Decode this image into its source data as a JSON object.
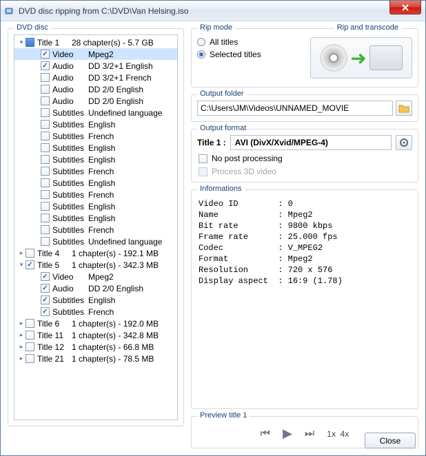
{
  "window": {
    "title": "DVD disc ripping from C:\\DVD\\Van Helsing.iso"
  },
  "tree": {
    "header": "DVD disc",
    "rows": [
      {
        "lvl": 0,
        "exp": "▾",
        "chk": "part",
        "c1": "Title 1",
        "c2": "28 chapter(s) - 5.7 GB"
      },
      {
        "lvl": 1,
        "chk": "on",
        "c1": "Video",
        "c2": "Mpeg2",
        "sel": true
      },
      {
        "lvl": 1,
        "chk": "on",
        "c1": "Audio",
        "c2": "DD 3/2+1 English"
      },
      {
        "lvl": 1,
        "chk": "off",
        "c1": "Audio",
        "c2": "DD 3/2+1 French"
      },
      {
        "lvl": 1,
        "chk": "off",
        "c1": "Audio",
        "c2": "DD 2/0 English"
      },
      {
        "lvl": 1,
        "chk": "off",
        "c1": "Audio",
        "c2": "DD 2/0 English"
      },
      {
        "lvl": 1,
        "chk": "off",
        "c1": "Subtitles",
        "c2": "Undefined language"
      },
      {
        "lvl": 1,
        "chk": "off",
        "c1": "Subtitles",
        "c2": "English"
      },
      {
        "lvl": 1,
        "chk": "off",
        "c1": "Subtitles",
        "c2": "French"
      },
      {
        "lvl": 1,
        "chk": "off",
        "c1": "Subtitles",
        "c2": "English"
      },
      {
        "lvl": 1,
        "chk": "off",
        "c1": "Subtitles",
        "c2": "English"
      },
      {
        "lvl": 1,
        "chk": "off",
        "c1": "Subtitles",
        "c2": "French"
      },
      {
        "lvl": 1,
        "chk": "off",
        "c1": "Subtitles",
        "c2": "English"
      },
      {
        "lvl": 1,
        "chk": "off",
        "c1": "Subtitles",
        "c2": "French"
      },
      {
        "lvl": 1,
        "chk": "off",
        "c1": "Subtitles",
        "c2": "English"
      },
      {
        "lvl": 1,
        "chk": "off",
        "c1": "Subtitles",
        "c2": "English"
      },
      {
        "lvl": 1,
        "chk": "off",
        "c1": "Subtitles",
        "c2": "French"
      },
      {
        "lvl": 1,
        "chk": "off",
        "c1": "Subtitles",
        "c2": "Undefined language"
      },
      {
        "lvl": 0,
        "exp": "▸",
        "chk": "off",
        "c1": "Title 4",
        "c2": "1 chapter(s) - 192.1 MB"
      },
      {
        "lvl": 0,
        "exp": "▾",
        "chk": "on",
        "c1": "Title 5",
        "c2": "1 chapter(s) - 342.3 MB"
      },
      {
        "lvl": 1,
        "chk": "on",
        "c1": "Video",
        "c2": "Mpeg2"
      },
      {
        "lvl": 1,
        "chk": "on",
        "c1": "Audio",
        "c2": "DD 2/0 English"
      },
      {
        "lvl": 1,
        "chk": "on",
        "c1": "Subtitles",
        "c2": "English"
      },
      {
        "lvl": 1,
        "chk": "on",
        "c1": "Subtitles",
        "c2": "French"
      },
      {
        "lvl": 0,
        "exp": "▸",
        "chk": "off",
        "c1": "Title 6",
        "c2": "1 chapter(s) - 192.0 MB"
      },
      {
        "lvl": 0,
        "exp": "▸",
        "chk": "off",
        "c1": "Title 11",
        "c2": "1 chapter(s) - 342.8 MB"
      },
      {
        "lvl": 0,
        "exp": "▸",
        "chk": "off",
        "c1": "Title 12",
        "c2": "1 chapter(s) - 66.8 MB"
      },
      {
        "lvl": 0,
        "exp": "▸",
        "chk": "off",
        "c1": "Title 21",
        "c2": "1 chapter(s) - 78.5 MB"
      }
    ]
  },
  "ripmode": {
    "title": "Rip mode",
    "all": "All titles",
    "selected": "Selected titles",
    "riptranscode": "Rip and transcode"
  },
  "outputfolder": {
    "title": "Output folder",
    "value": "C:\\Users\\JM\\Videos\\UNNAMED_MOVIE"
  },
  "outputformat": {
    "title": "Output format",
    "label": "Title 1 :",
    "value": "AVI (DivX/Xvid/MPEG-4)",
    "nopost": "No post processing",
    "process3d": "Process 3D video"
  },
  "info": {
    "title": "Informations",
    "rows": [
      {
        "k": "Video ID",
        "v": "0"
      },
      {
        "k": "Name",
        "v": "Mpeg2"
      },
      {
        "k": "Bit rate",
        "v": "9800 kbps"
      },
      {
        "k": "Frame rate",
        "v": "25.000 fps"
      },
      {
        "k": "Codec",
        "v": "V_MPEG2"
      },
      {
        "k": "Format",
        "v": "Mpeg2"
      },
      {
        "k": "Resolution",
        "v": "720 x 576"
      },
      {
        "k": "Display aspect",
        "v": "16:9 (1.78)"
      }
    ]
  },
  "preview": {
    "title": "Preview title 1",
    "s1": "1x",
    "s4": "4x"
  },
  "footer": {
    "close": "Close"
  }
}
